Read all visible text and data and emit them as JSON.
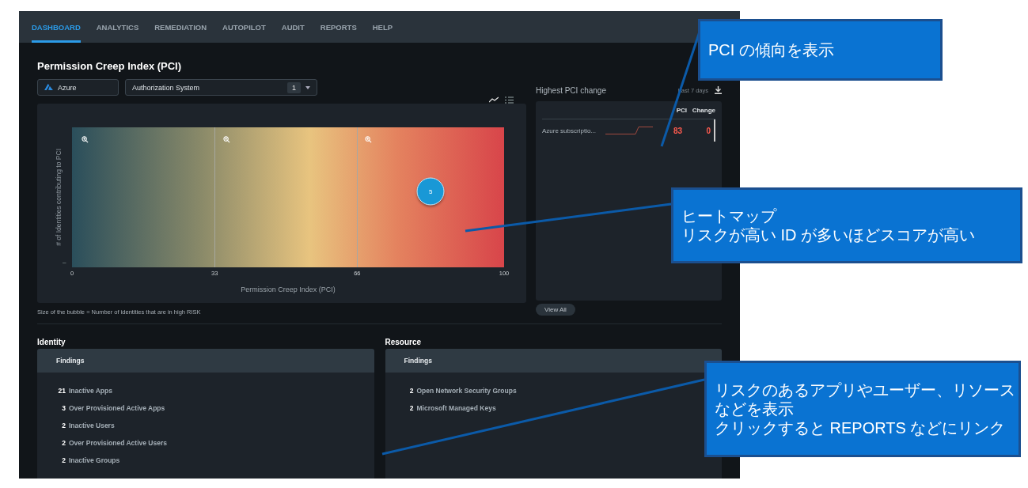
{
  "nav": [
    {
      "label": "DASHBOARD",
      "selected": true
    },
    {
      "label": "ANALYTICS",
      "selected": false
    },
    {
      "label": "REMEDIATION",
      "selected": false
    },
    {
      "label": "AUTOPILOT",
      "selected": false
    },
    {
      "label": "AUDIT",
      "selected": false
    },
    {
      "label": "REPORTS",
      "selected": false
    },
    {
      "label": "HELP",
      "selected": false
    }
  ],
  "title": "Permission Creep Index (PCI)",
  "filters": {
    "cloud": "Azure",
    "system": {
      "label": "Authorization System",
      "count": "1"
    }
  },
  "heatmap": {
    "ylabel": "# of Identities contributing to PCI",
    "xlabel": "Permission Creep Index (PCI)",
    "xticks": [
      "0",
      "33",
      "66",
      "100"
    ],
    "ytick": "–",
    "bubble": "5",
    "caption": "Size of the bubble = Number of identities that are in high RISK"
  },
  "pci_change": {
    "title": "Highest PCI change",
    "period": "Last 7 days",
    "columns": [
      "PCI",
      "Change"
    ],
    "rows": [
      {
        "name": "Azure subscriptio...",
        "pci": "83",
        "change": "0"
      }
    ],
    "button": "View All"
  },
  "sections": [
    {
      "title": "Identity",
      "header": "Findings",
      "findings": [
        {
          "count": "21",
          "label": "Inactive Apps"
        },
        {
          "count": "3",
          "label": "Over Provisioned Active Apps"
        },
        {
          "count": "2",
          "label": "Inactive Users"
        },
        {
          "count": "2",
          "label": "Over Provisioned Active Users"
        },
        {
          "count": "2",
          "label": "Inactive Groups"
        }
      ]
    },
    {
      "title": "Resource",
      "header": "Findings",
      "findings": [
        {
          "count": "2",
          "label": "Open Network Security Groups"
        },
        {
          "count": "2",
          "label": "Microsoft Managed Keys"
        }
      ]
    }
  ],
  "callouts": [
    {
      "lines": [
        "PCI の傾向を表示"
      ]
    },
    {
      "lines": [
        "ヒートマップ",
        "リスクが高い ID が多いほどスコアが高い"
      ]
    },
    {
      "lines": [
        "リスクのあるアプリやユーザー、リソース",
        "などを表示",
        "クリックすると REPORTS などにリンク"
      ]
    }
  ]
}
